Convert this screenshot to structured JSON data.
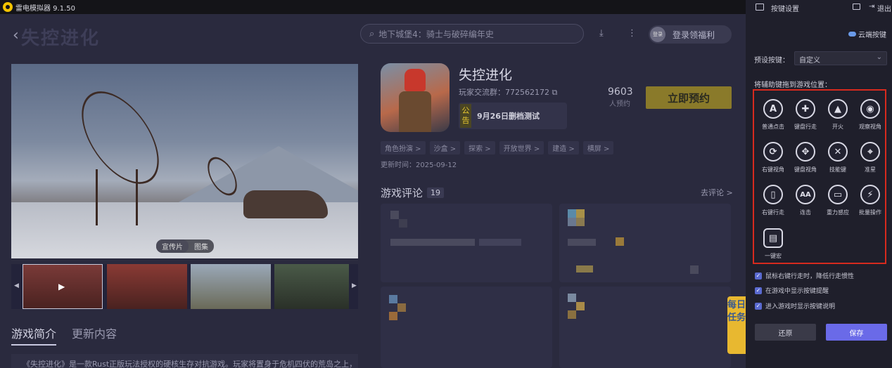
{
  "window": {
    "title": "雷电模拟器 9.1.50"
  },
  "header": {
    "search_placeholder": "地下城堡4：骑士与破碎编年史",
    "login_avatar": "登录",
    "login_label": "登录领福利",
    "bg_logo": "失控进化"
  },
  "banner": {
    "tabs": [
      "宣传片",
      "图集"
    ]
  },
  "game": {
    "title": "失控进化",
    "group": "玩家交流群：772562172",
    "notice_tag": "公告",
    "notice_text": "9月26日删档测试",
    "reserve_count": "9603",
    "reserve_unit": "人预约",
    "reserve_button": "立即预约",
    "tags": [
      "角色扮演 >",
      "沙盒 >",
      "探索 >",
      "开放世界 >",
      "建造 >",
      "横屏 >"
    ],
    "update_time": "更新时间：2025-09-12",
    "reviews_title": "游戏评论",
    "reviews_count": "19",
    "go_review": "去评论 >"
  },
  "content_tabs": {
    "intro": "游戏简介",
    "updates": "更新内容"
  },
  "intro_text": "《失控进化》是一款Rust正版玩法授权的硬核生存对抗游戏。玩家将置身于危机四伏的荒岛之上，",
  "daily_task": "每日任务",
  "panel": {
    "title": "按键设置",
    "exit": "退出",
    "cloud": "云端按键",
    "preset_label": "预设按键：",
    "preset_value": "自定义",
    "drag_label": "将辅助键拖到游戏位置：",
    "keys": [
      {
        "glyph": "A",
        "label": "普通点击",
        "icon": "letter-a-icon"
      },
      {
        "glyph": "✚",
        "label": "键盘行走",
        "icon": "dpad-icon"
      },
      {
        "glyph": "▲",
        "label": "开火",
        "icon": "bullet-icon"
      },
      {
        "glyph": "◉",
        "label": "观察视角",
        "icon": "eye-icon"
      },
      {
        "glyph": "⟳",
        "label": "右键视角",
        "icon": "rotate-view-icon"
      },
      {
        "glyph": "✥",
        "label": "键盘视角",
        "icon": "keyboard-view-icon"
      },
      {
        "glyph": "✕",
        "label": "技能键",
        "icon": "skill-swords-icon"
      },
      {
        "glyph": "⌖",
        "label": "准星",
        "icon": "crosshair-icon"
      },
      {
        "glyph": "▯",
        "label": "右键行走",
        "icon": "mouse-icon"
      },
      {
        "glyph": "AA",
        "label": "连击",
        "icon": "combo-icon"
      },
      {
        "glyph": "▭",
        "label": "重力感应",
        "icon": "gravity-phone-icon"
      },
      {
        "glyph": "⚡",
        "label": "批量操作",
        "icon": "lightning-icon"
      },
      {
        "glyph": "▤",
        "label": "一键宏",
        "icon": "macro-icon"
      }
    ],
    "options": [
      "鼠标右键行走时，降低行走惯性",
      "在游戏中显示按键提醒",
      "进入游戏时显示按键说明"
    ],
    "reset_button": "还原",
    "save_button": "保存"
  },
  "colors": {
    "accent": "#6a6ae8",
    "highlight_border": "#d62a1e",
    "reserve": "#8a7a2a"
  }
}
